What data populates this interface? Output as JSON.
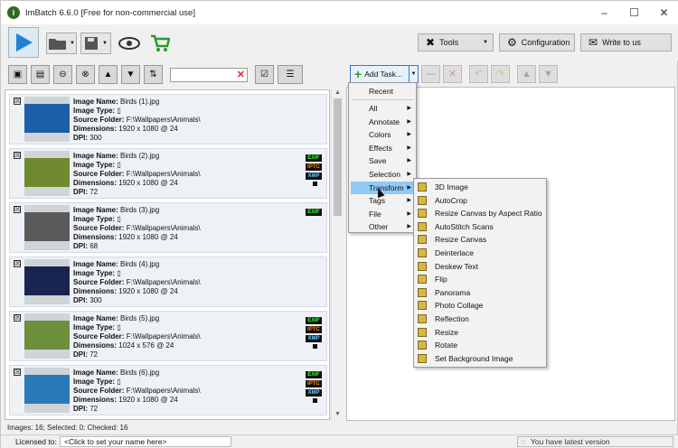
{
  "window": {
    "title": "ImBatch 6.6.0 [Free for non-commercial use]",
    "app_icon": "imbatch-logo-icon",
    "controls": [
      "minimize-icon",
      "maximize-icon",
      "close-icon"
    ]
  },
  "toolbar": {
    "tools_label": "Tools",
    "configuration_label": "Configuration",
    "write_label": "Write to us"
  },
  "search": {
    "placeholder": "",
    "value": ""
  },
  "images": [
    {
      "checked": "☒",
      "name_label": "Image Name:",
      "name": "Birds (1).jpg",
      "type_label": "Image Type:",
      "folder_label": "Source Folder:",
      "folder": "F:\\Wallpapers\\Animals\\",
      "dim_label": "Dimensions:",
      "dim": "1920 x 1080 @ 24",
      "dpi_label": "DPI:",
      "dpi": "300",
      "tags": [],
      "color": "#1b5fa8"
    },
    {
      "checked": "☒",
      "name_label": "Image Name:",
      "name": "Birds (2).jpg",
      "type_label": "Image Type:",
      "folder_label": "Source Folder:",
      "folder": "F:\\Wallpapers\\Animals\\",
      "dim_label": "Dimensions:",
      "dim": "1920 x 1080 @ 24",
      "dpi_label": "DPI:",
      "dpi": "72",
      "tags": [
        "EXIF",
        "IPTC",
        "XMP"
      ],
      "color": "#6f8a2e"
    },
    {
      "checked": "☒",
      "name_label": "Image Name:",
      "name": "Birds (3).jpg",
      "type_label": "Image Type:",
      "folder_label": "Source Folder:",
      "folder": "F:\\Wallpapers\\Animals\\",
      "dim_label": "Dimensions:",
      "dim": "1920 x 1080 @ 24",
      "dpi_label": "DPI:",
      "dpi": "68",
      "tags": [
        "EXIF"
      ],
      "color": "#5a5a5a"
    },
    {
      "checked": "☒",
      "name_label": "Image Name:",
      "name": "Birds (4).jpg",
      "type_label": "Image Type:",
      "folder_label": "Source Folder:",
      "folder": "F:\\Wallpapers\\Animals\\",
      "dim_label": "Dimensions:",
      "dim": "1920 x 1080 @ 24",
      "dpi_label": "DPI:",
      "dpi": "300",
      "tags": [],
      "color": "#1a2450"
    },
    {
      "checked": "☒",
      "name_label": "Image Name:",
      "name": "Birds (5).jpg",
      "type_label": "Image Type:",
      "folder_label": "Source Folder:",
      "folder": "F:\\Wallpapers\\Animals\\",
      "dim_label": "Dimensions:",
      "dim": "1024 x 576 @ 24",
      "dpi_label": "DPI:",
      "dpi": "72",
      "tags": [
        "EXIF",
        "IPTC",
        "XMP"
      ],
      "color": "#6b8f3a"
    },
    {
      "checked": "☒",
      "name_label": "Image Name:",
      "name": "Birds (6).jpg",
      "type_label": "Image Type:",
      "folder_label": "Source Folder:",
      "folder": "F:\\Wallpapers\\Animals\\",
      "dim_label": "Dimensions:",
      "dim": "1920 x 1080 @ 24",
      "dpi_label": "DPI:",
      "dpi": "72",
      "tags": [
        "EXIF",
        "IPTC",
        "XMP"
      ],
      "color": "#2a7ab8"
    }
  ],
  "status": {
    "summary": "Images: 16; Selected: 0; Checked: 16",
    "licensed_label": "Licensed to:",
    "licensed_value": "<Click to set your name here>",
    "version": "You have latest version"
  },
  "tasks": {
    "add_label": "Add Task..."
  },
  "menu": [
    {
      "label": "Recent",
      "sub": false
    },
    {
      "label": "All",
      "sub": true
    },
    {
      "label": "Annotate",
      "sub": true
    },
    {
      "label": "Colors",
      "sub": true
    },
    {
      "label": "Effects",
      "sub": true
    },
    {
      "label": "Save",
      "sub": true
    },
    {
      "label": "Selection",
      "sub": true
    },
    {
      "label": "Transform",
      "sub": true,
      "selected": true
    },
    {
      "label": "Tags",
      "sub": true
    },
    {
      "label": "File",
      "sub": true
    },
    {
      "label": "Other",
      "sub": true
    }
  ],
  "submenu": [
    "3D Image",
    "AutoCrop",
    "Resize Canvas by Aspect Ratio",
    "AutoStitch Scans",
    "Resize Canvas",
    "Deinterlace",
    "Deskew Text",
    "Flip",
    "Panorama",
    "Photo Collage",
    "Reflection",
    "Resize",
    "Rotate",
    "Set Background Image"
  ],
  "submenu_icons": [
    "cube-icon",
    "autocrop-icon",
    "aspect-ratio-icon",
    "stitch-icon",
    "canvas-icon",
    "deinterlace-icon",
    "deskew-icon",
    "flip-icon",
    "panorama-icon",
    "collage-icon",
    "reflection-icon",
    "resize-icon",
    "rotate-icon",
    "background-image-icon"
  ]
}
